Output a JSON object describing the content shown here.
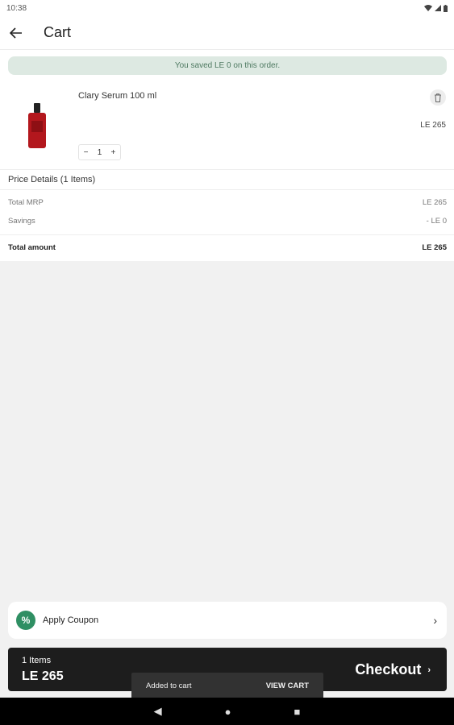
{
  "status_bar": {
    "time": "10:38"
  },
  "app_bar": {
    "title": "Cart"
  },
  "banner": {
    "text": "You saved LE 0 on this order."
  },
  "product": {
    "name": "Clary Serum 100 ml",
    "price": "LE 265",
    "quantity": "1",
    "minus": "−",
    "plus": "+"
  },
  "price_details": {
    "title": "Price Details (1 Items)",
    "rows": [
      {
        "label": "Total MRP",
        "value": "LE 265"
      },
      {
        "label": "Savings",
        "value": "- LE 0"
      }
    ],
    "total": {
      "label": "Total amount",
      "value": "LE 265"
    }
  },
  "coupon": {
    "icon": "%",
    "label": "Apply Coupon",
    "chevron": "›"
  },
  "checkout_bar": {
    "items": "1 Items",
    "total": "LE 265",
    "button": "Checkout",
    "chevron": "›"
  },
  "snackbar": {
    "message": "Added to cart",
    "action": "VIEW CART"
  },
  "nav": {
    "back": "◀",
    "home": "●",
    "recents": "■"
  }
}
